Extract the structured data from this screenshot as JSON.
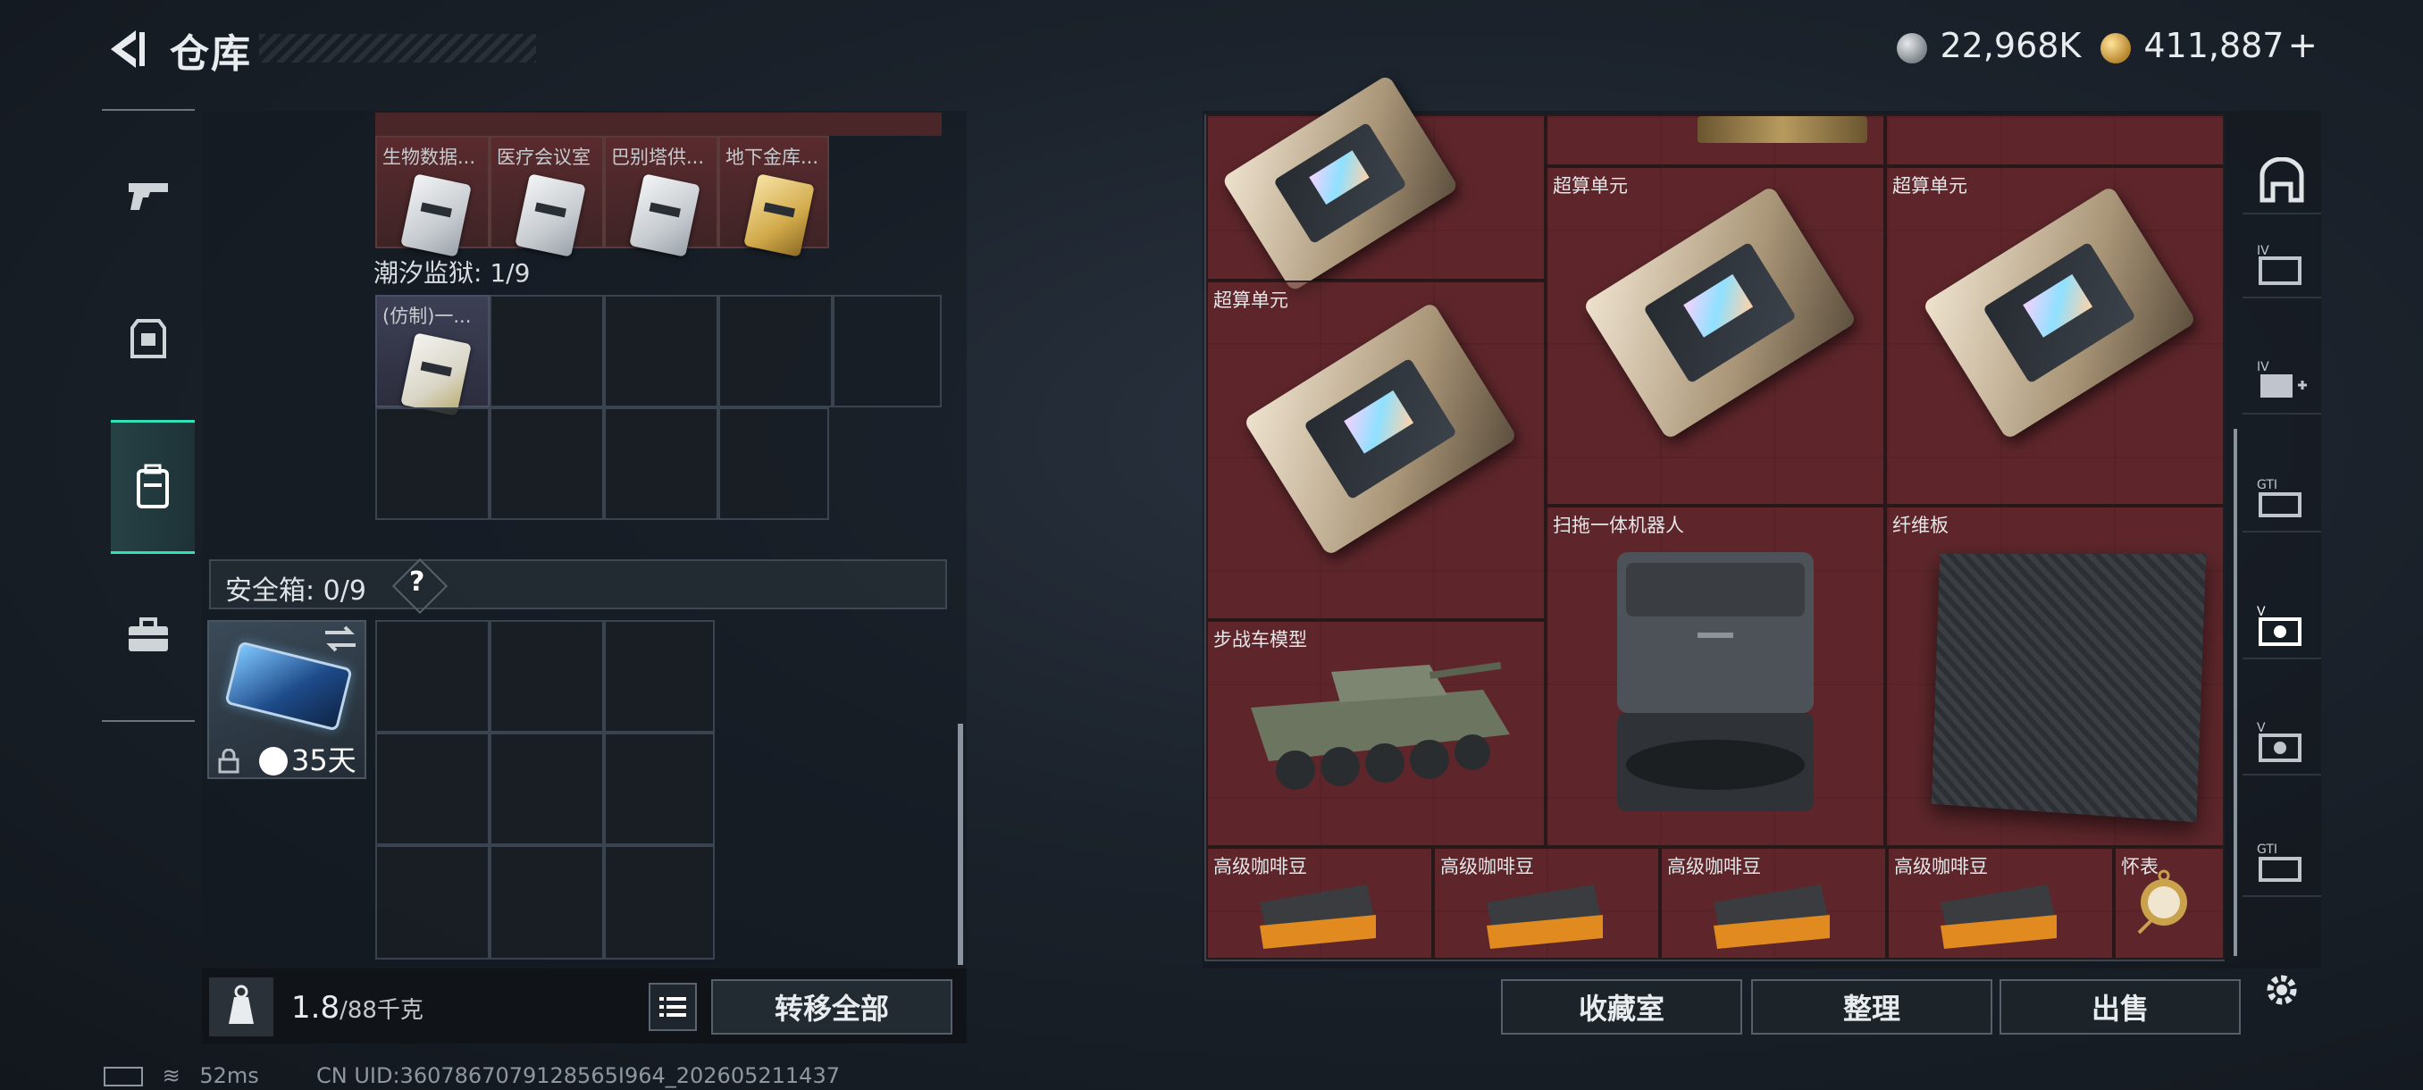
{
  "header": {
    "title": "仓库",
    "currency_silver": "22,968K",
    "currency_gold": "411,887",
    "plus_symbol": "+"
  },
  "left_panel": {
    "top_cards": [
      {
        "label": "生物数据...",
        "color": "silver"
      },
      {
        "label": "医疗会议室",
        "color": "silver"
      },
      {
        "label": "巴别塔供...",
        "color": "silver"
      },
      {
        "label": "地下金库...",
        "color": "gold"
      }
    ],
    "tide_label": "潮汐监狱: 1/9",
    "tide_card_label": "(仿制)一...",
    "safe_box_label": "安全箱: 0/9",
    "safe_box_help": "?",
    "case_days": "35天",
    "weight_value": "1.8",
    "weight_capacity": "/88千克",
    "transfer_all": "转移全部"
  },
  "inventory_items": {
    "chip_label": "超算单元",
    "robot_label": "扫拖一体机器人",
    "fiber_label": "纤维板",
    "tank_label": "步战车模型",
    "coffee_label": "高级咖啡豆",
    "watch_label": "怀表"
  },
  "buttons": {
    "collection": "收藏室",
    "organize": "整理",
    "sell": "出售"
  },
  "status": {
    "ping": "52ms",
    "uid": "CN UID:3607867079128565I964_202605211437"
  },
  "icons": {
    "back": "back-arrow-icon",
    "weapons": "pistol-icon",
    "armor": "armor-icon",
    "backpack": "backpack-icon",
    "toolbox": "toolbox-icon",
    "settings": "gear-icon"
  },
  "colors": {
    "accent": "#2fe0b8",
    "item_bg": "#5a2529"
  }
}
